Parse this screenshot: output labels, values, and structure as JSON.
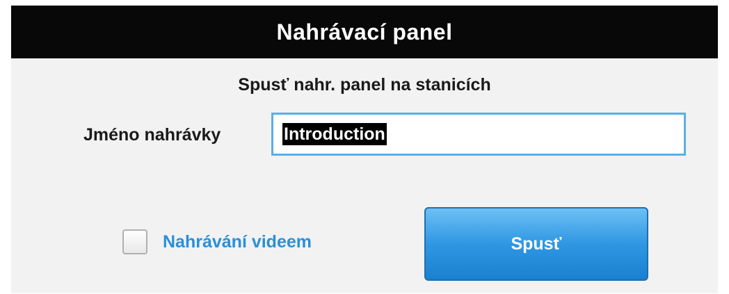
{
  "panel": {
    "title": "Nahrávací panel",
    "subtitle": "Spusť nahr. panel na stanicích"
  },
  "recording_name": {
    "label": "Jméno nahrávky",
    "value": "Introduction"
  },
  "video_option": {
    "label": "Nahrávání videem",
    "checked": false
  },
  "start_button": {
    "label": "Spusť"
  },
  "colors": {
    "titlebar": "#080808",
    "accent_blue": "#2a8fd8",
    "input_border": "#5aaee6",
    "button_blue": "#2f97e2"
  }
}
